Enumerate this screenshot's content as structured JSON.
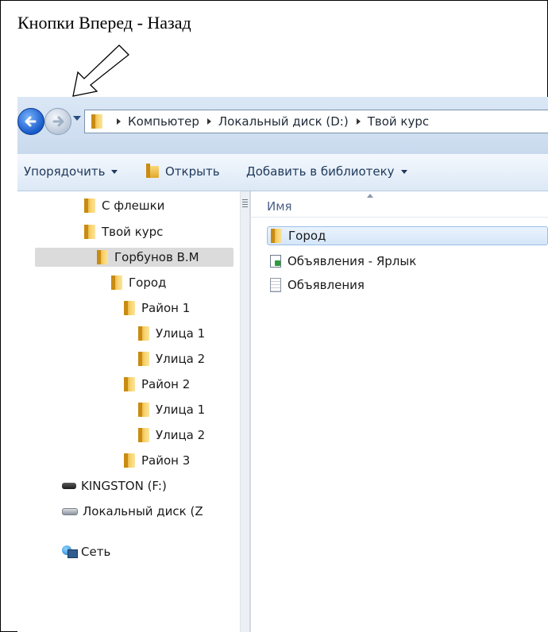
{
  "caption": "Кнопки Вперед - Назад",
  "address_bar": {
    "crumbs": [
      "Компьютер",
      "Локальный диск (D:)",
      "Твой курс"
    ]
  },
  "toolbar": {
    "organize": "Упорядочить",
    "open": "Открыть",
    "add_to_library": "Добавить в библиотеку"
  },
  "nav_tree": {
    "items": [
      {
        "label": "С флешки",
        "icon": "folder-icon"
      },
      {
        "label": "Твой курс",
        "icon": "folder-icon"
      },
      {
        "label": "Горбунов В.М",
        "icon": "folder-icon",
        "selected": true
      },
      {
        "label": "Город",
        "icon": "folder-icon"
      },
      {
        "label": "Район 1",
        "icon": "folder-icon"
      },
      {
        "label": "Улица 1",
        "icon": "folder-icon"
      },
      {
        "label": "Улица 2",
        "icon": "folder-icon"
      },
      {
        "label": "Район 2",
        "icon": "folder-icon"
      },
      {
        "label": "Улица 1",
        "icon": "folder-icon"
      },
      {
        "label": "Улица 2",
        "icon": "folder-icon"
      },
      {
        "label": "Район 3",
        "icon": "folder-icon"
      },
      {
        "label": "KINGSTON (F:)",
        "icon": "usb-drive-icon"
      },
      {
        "label": "Локальный диск (Z",
        "icon": "hard-drive-icon"
      },
      {
        "label": "Сеть",
        "icon": "network-icon"
      }
    ]
  },
  "content": {
    "column_header": "Имя",
    "files": [
      {
        "name": "Город",
        "icon": "folder-icon",
        "selected": true
      },
      {
        "name": "Объявления - Ярлык",
        "icon": "shortcut-icon"
      },
      {
        "name": "Объявления",
        "icon": "text-document-icon"
      }
    ]
  }
}
